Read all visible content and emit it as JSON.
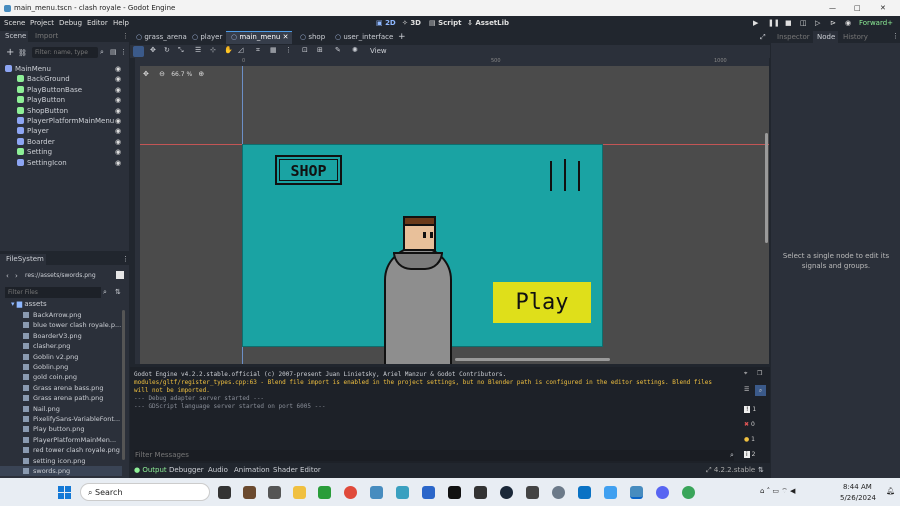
{
  "window": {
    "title": "main_menu.tscn - clash royale - Godot Engine",
    "controls": [
      "—",
      "□",
      "✕"
    ]
  },
  "menu": [
    "Scene",
    "Project",
    "Debug",
    "Editor",
    "Help"
  ],
  "workspaces": [
    "2D",
    "3D",
    "Script",
    "AssetLib"
  ],
  "renderer": "Forward+",
  "scene_tabs": [
    "grass_arena",
    "player",
    "main_menu",
    "shop",
    "user_interface"
  ],
  "scene_dock": {
    "tabs": [
      "Scene",
      "Import"
    ],
    "filter_placeholder": "Filter: name, type",
    "nodes": [
      {
        "name": "MainMenu",
        "color": "#8da5f3"
      },
      {
        "name": "BackGround",
        "color": "#8eef97"
      },
      {
        "name": "PlayButtonBase",
        "color": "#8eef97"
      },
      {
        "name": "PlayButton",
        "color": "#8eef97"
      },
      {
        "name": "ShopButton",
        "color": "#8eef97"
      },
      {
        "name": "PlayerPlatformMainMenu",
        "color": "#8da5f3"
      },
      {
        "name": "Player",
        "color": "#8da5f3"
      },
      {
        "name": "Boarder",
        "color": "#8da5f3"
      },
      {
        "name": "Setting",
        "color": "#8eef97"
      },
      {
        "name": "SettingIcon",
        "color": "#8da5f3"
      }
    ]
  },
  "filesystem": {
    "title": "FileSystem",
    "path": "res://assets/swords.png",
    "filter_placeholder": "Filter Files",
    "folder": "assets",
    "files": [
      "BackArrow.png",
      "blue tower clash royale.p...",
      "BoarderV3.png",
      "clasher.png",
      "Goblin v2.png",
      "Goblin.png",
      "gold coin.png",
      "Grass arena bass.png",
      "Grass arena path.png",
      "Nail.png",
      "PixelifySans-VariableFont...",
      "Play button.png",
      "PlayerPlatformMainMen...",
      "red tower clash royale.png",
      "setting icon.png",
      "swords.png"
    ]
  },
  "toolbar": {
    "view_label": "View",
    "zoom": "66.7 %",
    "ruler": [
      "0",
      "500",
      "1000"
    ]
  },
  "game": {
    "shop_label": "SHOP",
    "play_label": "Play"
  },
  "output": {
    "lines": [
      "Godot Engine v4.2.2.stable.official (c) 2007-present Juan Linietsky, Ariel Manzur & Godot Contributors.",
      "modules/gltf/register_types.cpp:63 - Blend file import is enabled in the project settings, but no Blender path is configured in the editor settings. Blend files",
      "will not be imported.",
      "--- Debug adapter server started ---",
      "--- GDScript language server started on port 6005 ---"
    ],
    "filter_placeholder": "Filter Messages",
    "counts": [
      "1",
      "0",
      "1",
      "2"
    ],
    "bottom_tabs": [
      "Output",
      "Debugger",
      "Audio",
      "Animation",
      "Shader Editor"
    ],
    "version": "4.2.2.stable"
  },
  "inspector": {
    "tabs": [
      "Inspector",
      "Node",
      "History"
    ],
    "message": "Select a single node to edit its signals and groups."
  },
  "taskbar": {
    "search": "Search",
    "time": "8:44 AM",
    "date": "5/26/2024"
  },
  "colors": {
    "teal": "#1aa3a3",
    "play": "#dfdf1a",
    "accent": "#4d9ce8"
  }
}
